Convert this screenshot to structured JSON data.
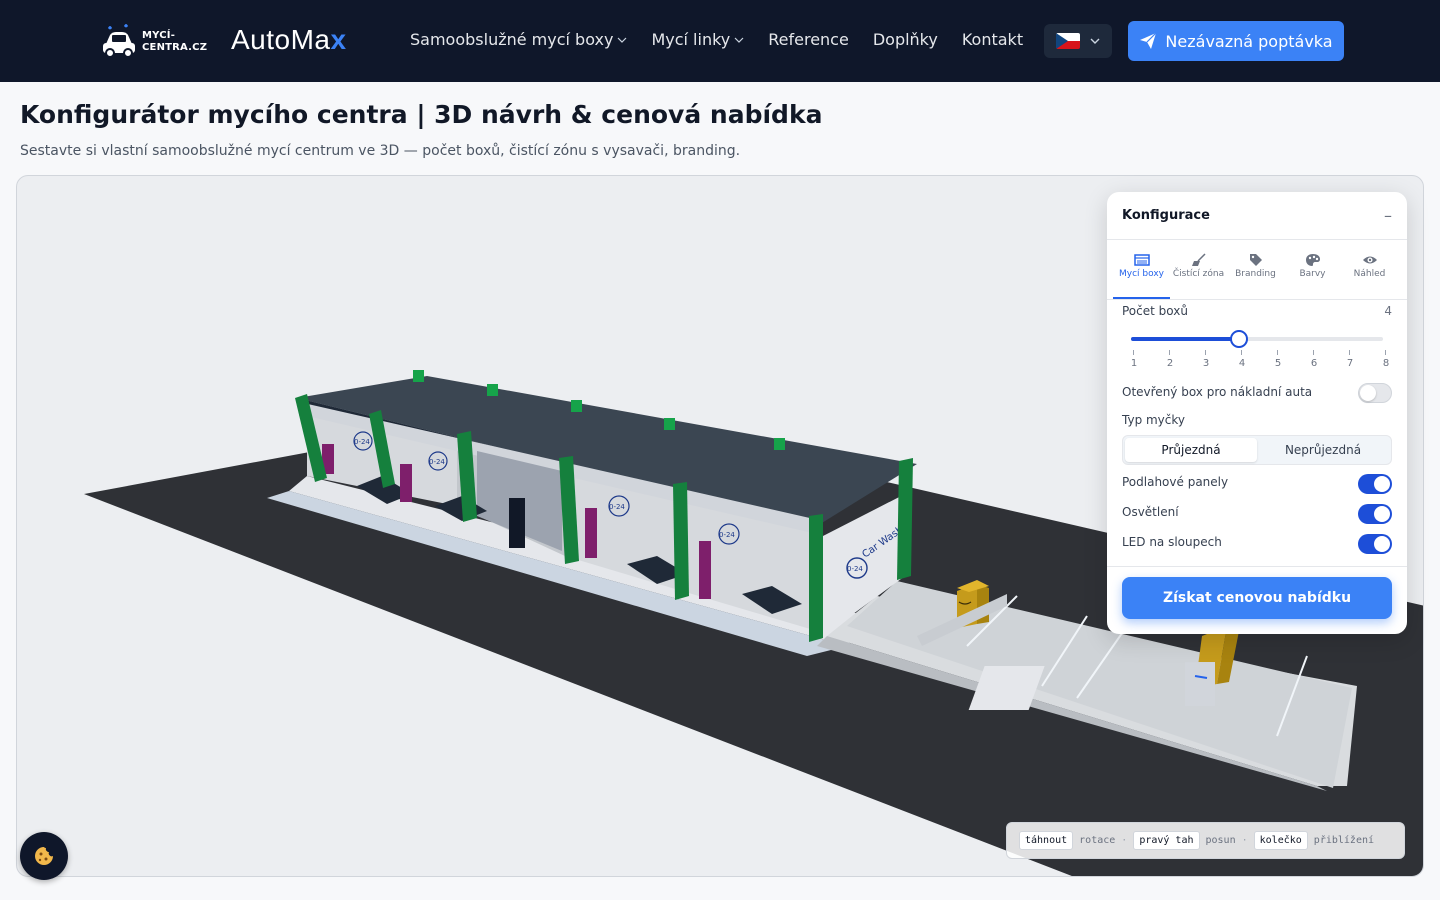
{
  "header": {
    "logo_primary_line1": "MYCÍ-",
    "logo_primary_line2": "CENTRA.CZ",
    "logo_secondary_main": "AutoMa",
    "logo_secondary_accent": "x",
    "nav": [
      {
        "label": "Samoobslužné mycí boxy",
        "has_dropdown": true
      },
      {
        "label": "Mycí linky",
        "has_dropdown": true
      },
      {
        "label": "Reference",
        "has_dropdown": false
      },
      {
        "label": "Doplňky",
        "has_dropdown": false
      },
      {
        "label": "Kontakt",
        "has_dropdown": false
      }
    ],
    "language": "cz",
    "cta_label": "Nezávazná poptávka"
  },
  "page": {
    "title": "Konfigurátor mycího centra | 3D návrh & cenová nabídka",
    "subtitle": "Sestavte si vlastní samoobslužné mycí centrum ve 3D — počet boxů, čistící zónu s vysavači, branding."
  },
  "config": {
    "title": "Konfigurace",
    "tabs": [
      {
        "label": "Mycí boxy",
        "icon": "boxes-icon",
        "active": true
      },
      {
        "label": "Čistící zóna",
        "icon": "broom-icon",
        "active": false
      },
      {
        "label": "Branding",
        "icon": "tag-icon",
        "active": false
      },
      {
        "label": "Barvy",
        "icon": "palette-icon",
        "active": false
      },
      {
        "label": "Náhled",
        "icon": "eye-icon",
        "active": false
      }
    ],
    "box_count_label": "Počet boxů",
    "box_count_value": "4",
    "box_count_min": 1,
    "box_count_max": 8,
    "slider_ticks": [
      "1",
      "2",
      "3",
      "4",
      "5",
      "6",
      "7",
      "8"
    ],
    "truck_box_label": "Otevřený box pro nákladní auta",
    "truck_box_on": false,
    "type_label": "Typ myčky",
    "type_options": [
      "Průjezdná",
      "Neprůjezdná"
    ],
    "type_selected": "Průjezdná",
    "floor_panels_label": "Podlahové panely",
    "floor_panels_on": true,
    "lighting_label": "Osvětlení",
    "lighting_on": true,
    "led_label": "LED na sloupech",
    "led_on": true,
    "quote_button": "Získat cenovou nabídku"
  },
  "hints": {
    "drag_key": "táhnout",
    "drag_action": "rotace",
    "right_key": "pravý tah",
    "right_action": "posun",
    "wheel_key": "kolečko",
    "wheel_action": "přiblížení",
    "separator": "·"
  },
  "scene": {
    "sign_text": "0-24",
    "brand_text": "Car Wash"
  },
  "colors": {
    "header_bg": "#0f172a",
    "accent": "#3b82f6",
    "pillar_green": "#1f7a2e",
    "roof": "#3b4652",
    "ground": "#2f3136"
  }
}
